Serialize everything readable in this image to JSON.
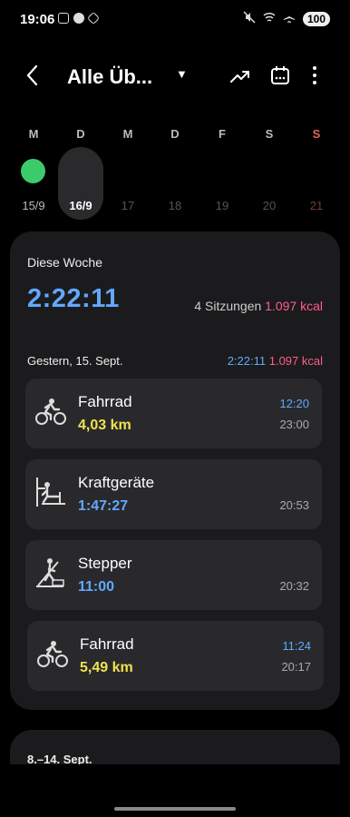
{
  "status_bar": {
    "time": "19:06",
    "battery": "100",
    "icons": [
      "screenshot-icon",
      "notification-icon",
      "app-icon",
      "mute-icon",
      "wifi-icon",
      "airplane-icon"
    ]
  },
  "app_bar": {
    "title": "Alle Üb...",
    "caret": "▼",
    "back_icon": "‹",
    "trend_icon": "trend-icon",
    "calendar_icon": "calendar-icon",
    "more_icon": "more-icon"
  },
  "week_strip": {
    "days": [
      {
        "letter": "M",
        "date": "15/9"
      },
      {
        "letter": "D",
        "date": "16/9"
      },
      {
        "letter": "M",
        "date": "17"
      },
      {
        "letter": "D",
        "date": "18"
      },
      {
        "letter": "F",
        "date": "19"
      },
      {
        "letter": "S",
        "date": "20"
      },
      {
        "letter": "S",
        "date": "21"
      }
    ],
    "colors": {
      "sunday": "#e0655a",
      "done_dot": "#3ccb6a"
    }
  },
  "this_week": {
    "label": "Diese Woche",
    "total_time": "2:22:11",
    "sessions": "4 Sitzungen",
    "kcal": "1.097 kcal"
  },
  "day_group": {
    "label": "Gestern, 15. Sept.",
    "time": "2:22:11",
    "kcal": "1.097 kcal"
  },
  "workouts": [
    {
      "name": "Fahrrad",
      "value": "4,03 km",
      "start": "12:20",
      "end": "23:00",
      "icon": "cycling-icon"
    },
    {
      "name": "Kraftgeräte",
      "value": "1:47:27",
      "start": "",
      "end": "20:53",
      "icon": "weight-machine-icon"
    },
    {
      "name": "Stepper",
      "value": "11:00",
      "start": "",
      "end": "20:32",
      "icon": "stepper-icon"
    },
    {
      "name": "Fahrrad",
      "value": "5,49 km",
      "start": "11:24",
      "end": "20:17",
      "icon": "cycling-icon"
    }
  ],
  "previous_week": {
    "label": "8.–14. Sept."
  },
  "colors": {
    "accent_blue": "#62a8ff",
    "kcal_pink": "#ff5d8f",
    "distance_yellow": "#f0e24d"
  }
}
